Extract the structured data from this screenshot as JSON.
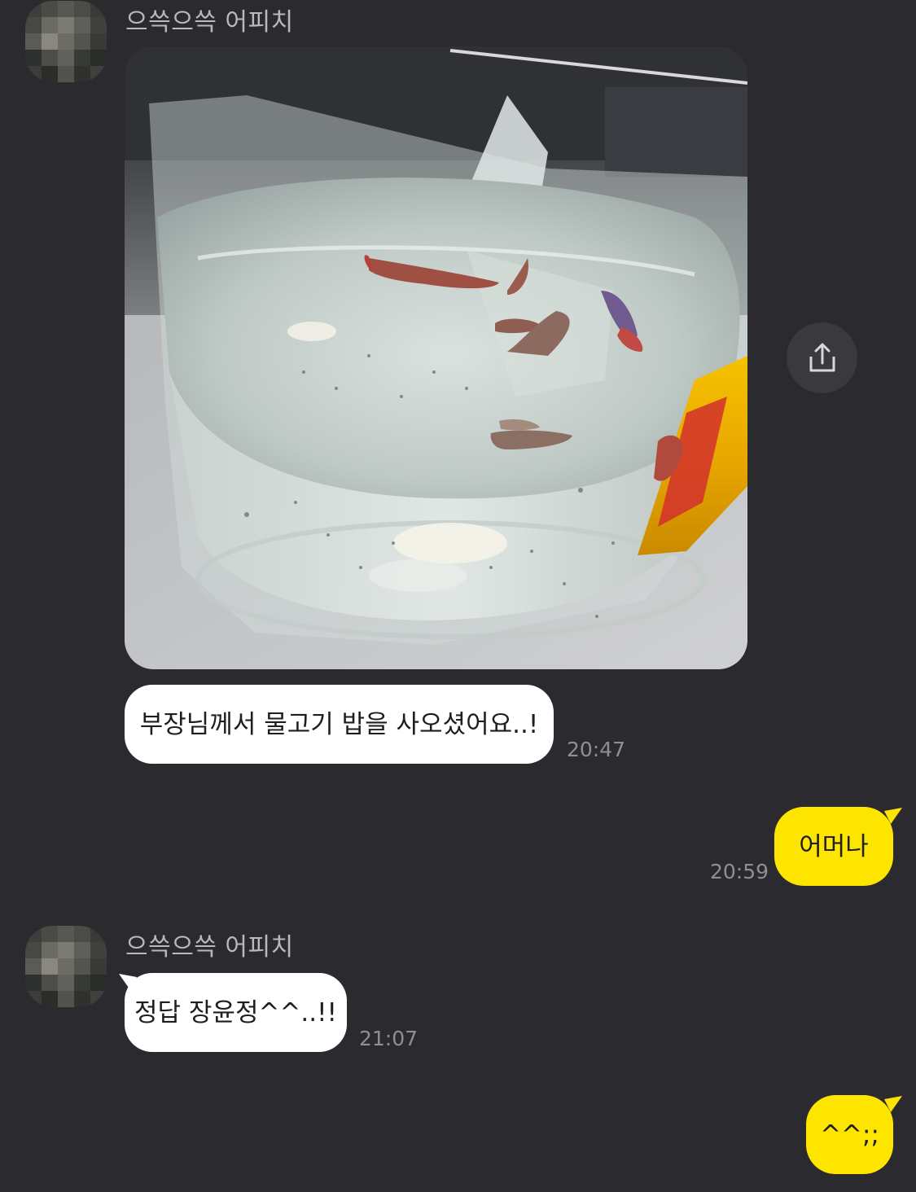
{
  "messages": [
    {
      "sender": "으쓱으쓱 어피치",
      "type": "photo",
      "photo_alt": "fish-in-cup-photo"
    },
    {
      "text": "부장님께서 물고기 밥을 사오셨어요..!",
      "time": "20:47"
    },
    {
      "text": "어머나",
      "time": "20:59"
    },
    {
      "sender": "으쓱으쓱 어피치",
      "text": "정답 장윤정^^..!!",
      "time": "21:07"
    },
    {
      "text": "^^;;"
    }
  ],
  "icons": {
    "share": "share-icon"
  },
  "colors": {
    "background": "#2b2b2f",
    "incoming_bubble": "#ffffff",
    "outgoing_bubble": "#fee500",
    "timestamp": "#8e8e93",
    "sender_name": "#b9b9bd"
  }
}
